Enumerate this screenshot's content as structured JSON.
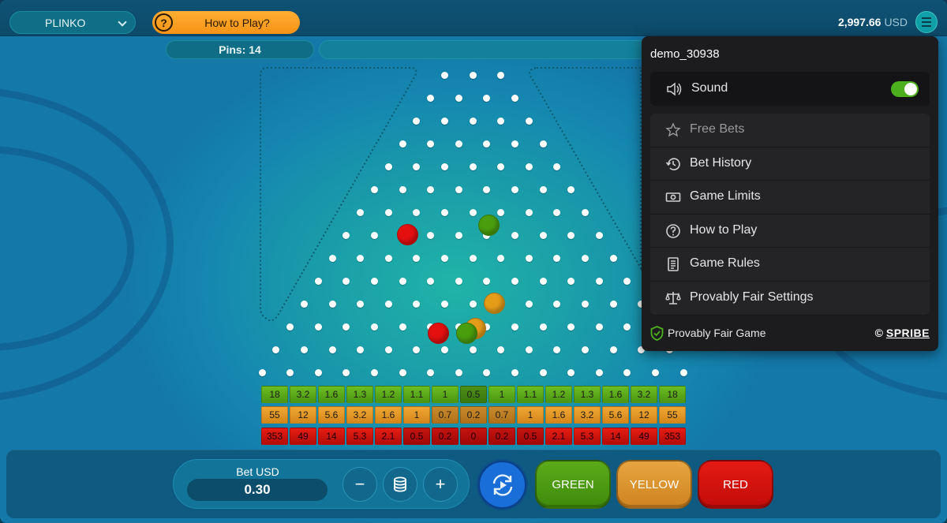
{
  "header": {
    "game_name": "PLINKO",
    "how_to_play": "How to Play?",
    "balance": "2,997.66",
    "currency": "USD"
  },
  "board": {
    "pins_label": "Pins: 14",
    "pin_rows": 14,
    "balls": [
      {
        "color": "red",
        "row": 7,
        "offset": -2.3
      },
      {
        "color": "green",
        "row": 6.6,
        "offset": 0.6
      },
      {
        "color": "yellow",
        "row": 10,
        "offset": 0.8
      },
      {
        "color": "yellow",
        "row": 11.1,
        "offset": 0.1
      },
      {
        "color": "green",
        "row": 11.3,
        "offset": -0.2
      },
      {
        "color": "red",
        "row": 11.3,
        "offset": -1.2
      }
    ]
  },
  "multipliers": {
    "green": [
      "18",
      "3.2",
      "1.6",
      "1.3",
      "1.2",
      "1.1",
      "1",
      "0.5",
      "1",
      "1.1",
      "1.2",
      "1.3",
      "1.6",
      "3.2",
      "18"
    ],
    "yellow": [
      "55",
      "12",
      "5.6",
      "3.2",
      "1.6",
      "1",
      "0.7",
      "0.2",
      "0.7",
      "1",
      "1.6",
      "3.2",
      "5.6",
      "12",
      "55"
    ],
    "red": [
      "353",
      "49",
      "14",
      "5.3",
      "2.1",
      "0.5",
      "0.2",
      "0",
      "0.2",
      "0.5",
      "2.1",
      "5.3",
      "14",
      "49",
      "353"
    ]
  },
  "controls": {
    "bet_label": "Bet USD",
    "bet_value": "0.30",
    "minus": "−",
    "plus": "+",
    "green_label": "GREEN",
    "yellow_label": "YELLOW",
    "red_label": "RED"
  },
  "menu": {
    "username": "demo_30938",
    "sound_label": "Sound",
    "sound_on": true,
    "items": [
      {
        "label": "Free Bets",
        "icon": "star-icon",
        "disabled": true
      },
      {
        "label": "Bet History",
        "icon": "history-icon",
        "disabled": false
      },
      {
        "label": "Game Limits",
        "icon": "money-icon",
        "disabled": false
      },
      {
        "label": "How to Play",
        "icon": "question-icon",
        "disabled": false
      },
      {
        "label": "Game Rules",
        "icon": "document-icon",
        "disabled": false
      },
      {
        "label": "Provably Fair Settings",
        "icon": "scales-icon",
        "disabled": false
      }
    ],
    "footer_fair": "Provably Fair Game",
    "footer_copyright": "©",
    "footer_brand": "SPRIBE"
  },
  "colors": {
    "accent_orange": "#f79316",
    "green": "#4c9512",
    "yellow": "#d5861a",
    "red": "#c10c08",
    "toggle_on": "#4caf1d"
  }
}
